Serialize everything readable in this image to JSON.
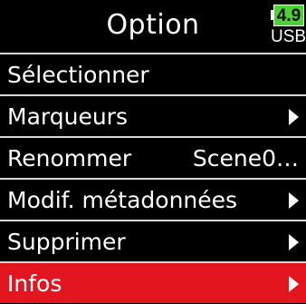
{
  "header": {
    "title": "Option",
    "battery": {
      "level": "4.9",
      "source": "USB"
    }
  },
  "menu": {
    "items": [
      {
        "label": "Sélectionner",
        "value": "",
        "submenu": false,
        "selected": false
      },
      {
        "label": "Marqueurs",
        "value": "",
        "submenu": true,
        "selected": false
      },
      {
        "label": "Renommer",
        "value": "Scene0…",
        "submenu": false,
        "selected": false
      },
      {
        "label": "Modif. métadonnées",
        "value": "",
        "submenu": true,
        "selected": false
      },
      {
        "label": "Supprimer",
        "value": "",
        "submenu": true,
        "selected": false
      },
      {
        "label": "Infos",
        "value": "",
        "submenu": true,
        "selected": true
      }
    ]
  },
  "colors": {
    "background": "#000000",
    "selection": "#e3151f",
    "battery": "#4cd137",
    "divider": "#d8d8d8"
  },
  "icons": {
    "submenu": "triangle-right-icon",
    "battery": "battery-icon"
  }
}
